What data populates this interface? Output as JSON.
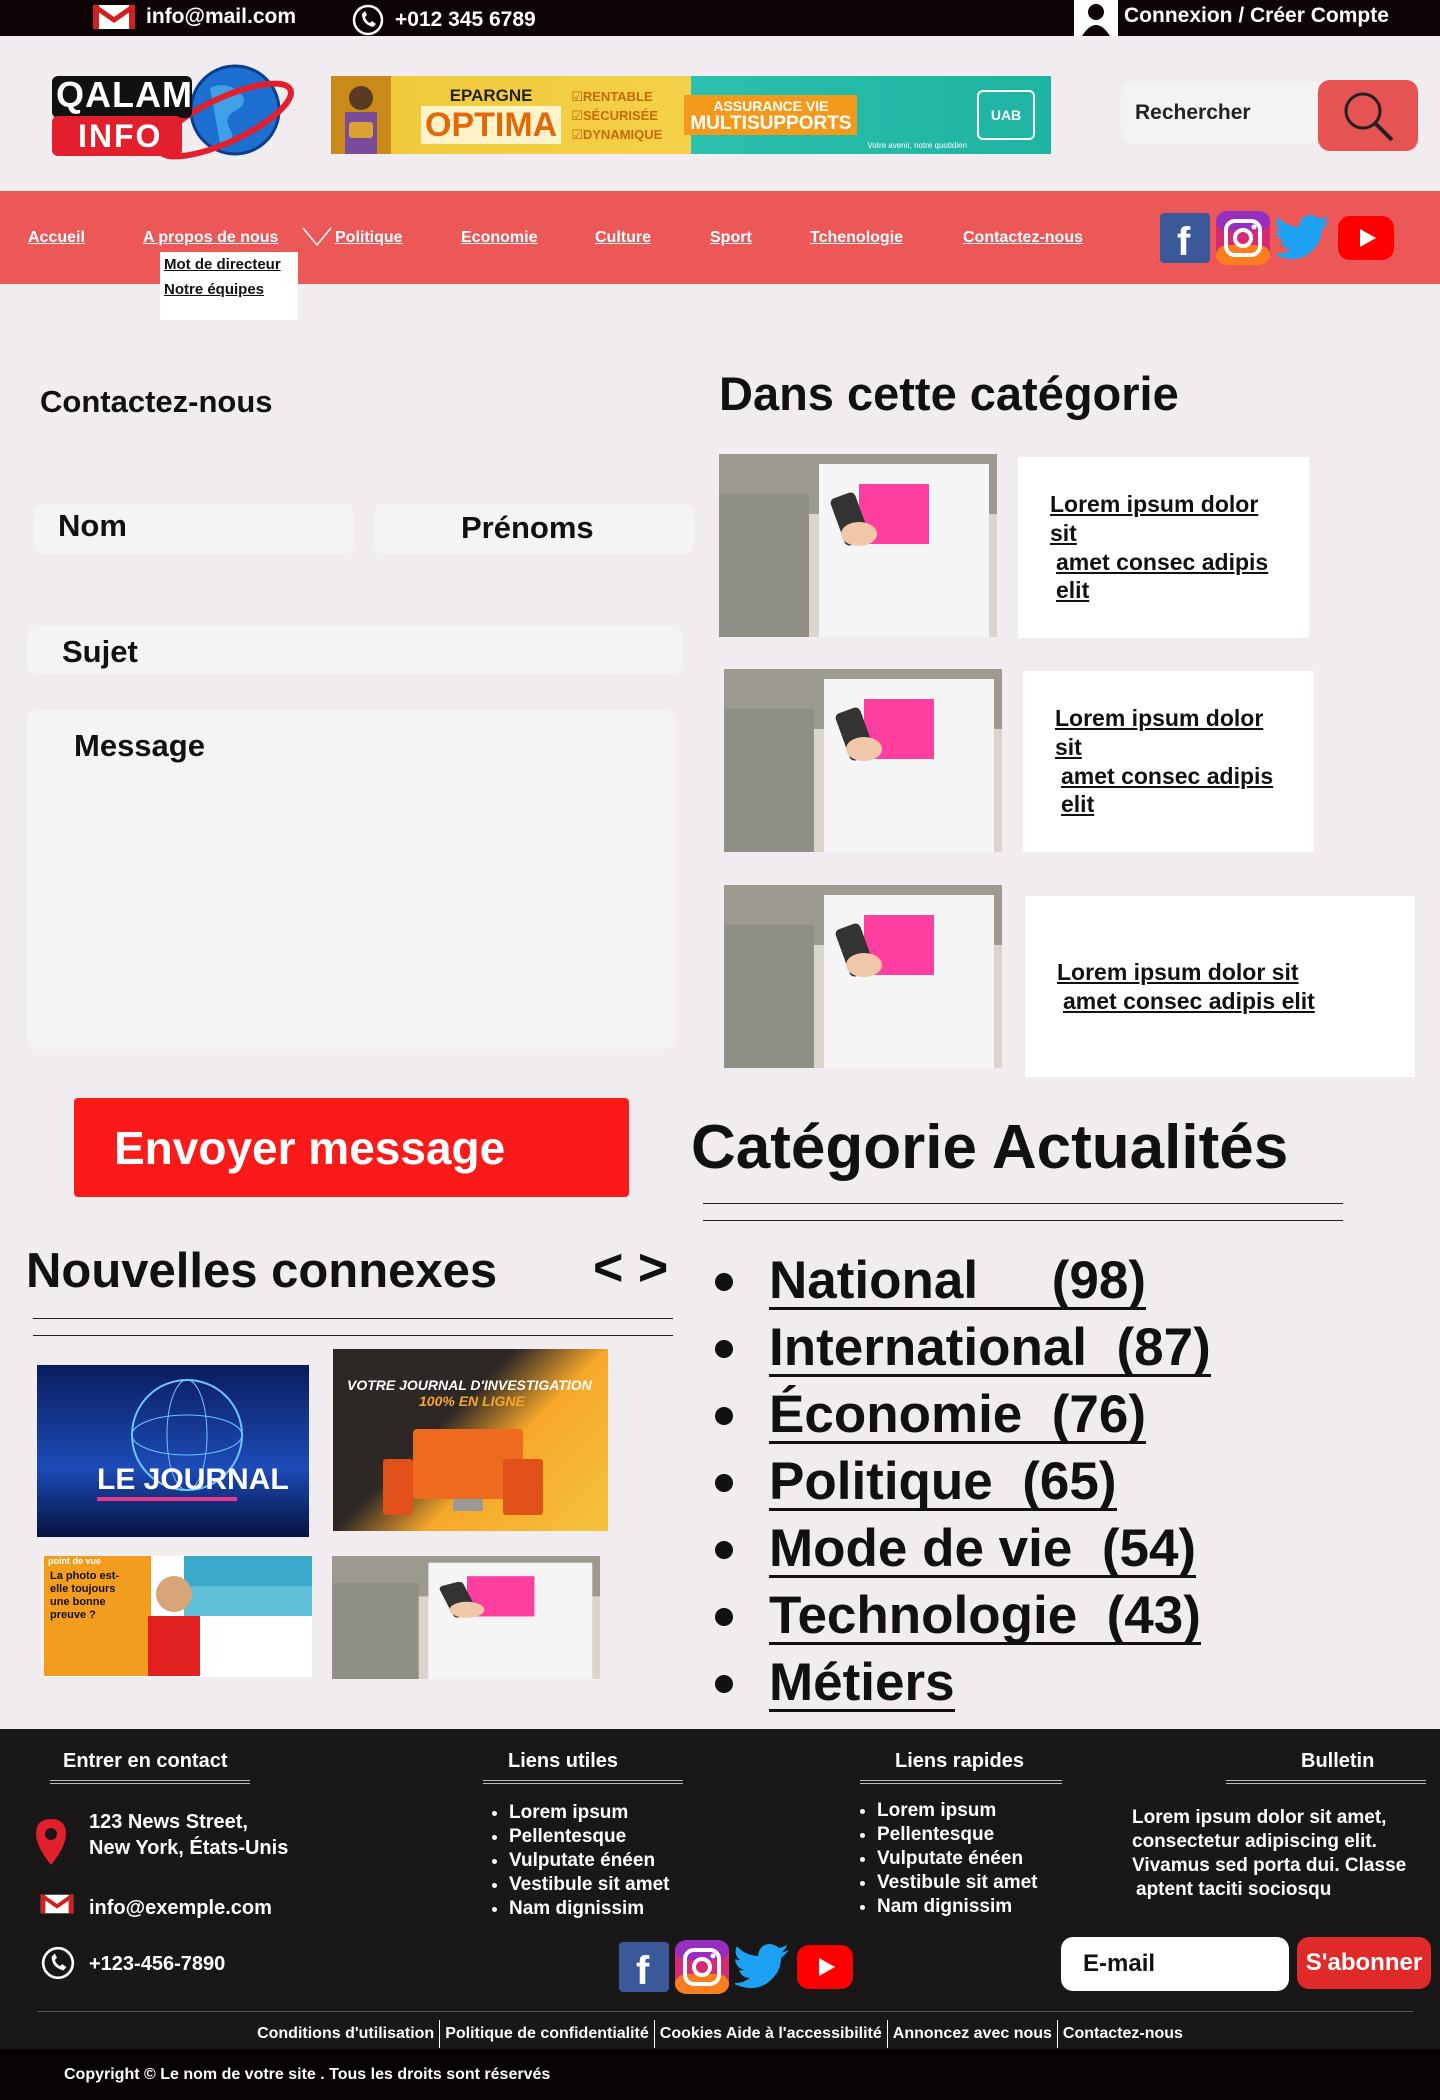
{
  "topbar": {
    "email": "info@mail.com",
    "phone": "+012 345 6789",
    "login": "Connexion / Créer Compte"
  },
  "header": {
    "logo_line1": "QALAM",
    "logo_line2": "INFO",
    "ad": {
      "label_small": "EPARGNE",
      "label_big": "OPTIMA",
      "checks": [
        "RENTABLE",
        "SÉCURISÉE",
        "DYNAMIQUE"
      ],
      "assurance_1": "ASSURANCE VIE",
      "assurance_2": "MULTISUPPORTS",
      "brand": "UAB",
      "tagline": "Votre avenir, notre quotidien"
    },
    "search_label": "Rechercher"
  },
  "nav": {
    "items": [
      "Accueil",
      "A propos de nous",
      "Politique",
      "Economie",
      "Culture",
      "Sport",
      "Tchenologie",
      "Contactez-nous"
    ],
    "dropdown": [
      "Mot de directeur",
      "Notre équipes"
    ]
  },
  "contact": {
    "title": "Contactez-nous",
    "nom": "Nom",
    "prenoms": "Prénoms",
    "sujet": "Sujet",
    "message": "Message",
    "send": "Envoyer message"
  },
  "category": {
    "title": "Dans cette catégorie",
    "cards": [
      {
        "line1": "Lorem ipsum dolor sit",
        "line2": "amet consec adipis elit"
      },
      {
        "line1": "Lorem ipsum dolor sit",
        "line2": "amet consec adipis elit"
      },
      {
        "line1": "Lorem ipsum dolor sit",
        "line2": "amet consec adipis elit"
      }
    ]
  },
  "related": {
    "title": "Nouvelles connexes",
    "arrows": "< >",
    "thumb1": "LE JOURNAL",
    "thumb2_line1": "VOTRE JOURNAL D'INVESTIGATION",
    "thumb2_line2": "100% EN LIGNE",
    "thumb3_tag": "point de vue",
    "thumb3_text": "La photo est-elle toujours une bonne preuve ?"
  },
  "actualites": {
    "title": "Catégorie Actualités",
    "items": [
      {
        "name": "National",
        "count": "(98)"
      },
      {
        "name": "International",
        "count": "(87)"
      },
      {
        "name": "Économie",
        "count": "(76)"
      },
      {
        "name": "Politique",
        "count": "(65)"
      },
      {
        "name": "Mode de vie",
        "count": "(54)"
      },
      {
        "name": "Technologie",
        "count": "(43)"
      },
      {
        "name": "Métiers",
        "count": ""
      }
    ]
  },
  "footer": {
    "contact_title": "Entrer en contact",
    "address1": "123 News Street,",
    "address2": "New York, États-Unis",
    "email": "info@exemple.com",
    "phone": "+123-456-7890",
    "useful_title": "Liens utiles",
    "useful_links": [
      "Lorem ipsum",
      "Pellentesque",
      "Vulputate énéen",
      "Vestibule sit amet",
      "Nam dignissim"
    ],
    "quick_title": "Liens rapides",
    "quick_links": [
      "Lorem ipsum",
      "Pellentesque",
      "Vulputate énéen",
      "Vestibule sit amet",
      "Nam dignissim"
    ],
    "bulletin_title": "Bulletin",
    "bulletin_text": [
      "Lorem ipsum dolor sit amet,",
      "consectetur adipiscing elit.",
      "Vivamus sed porta dui. Classe",
      " aptent taciti sociosqu"
    ],
    "email_placeholder": "E-mail",
    "subscribe": "S'abonner",
    "bottom_links": [
      "Conditions  d'utilisation",
      "Politique de confidentialité",
      "Cookies  Aide à l'accessibilité",
      "Annoncez avec nous",
      "Contactez-nous"
    ],
    "copyright": "Copyright © Le nom de votre site . Tous les droits sont réservés"
  },
  "colors": {
    "accent": "#ec5858",
    "button_red": "#fa1a1a",
    "dark": "#1a1718"
  }
}
